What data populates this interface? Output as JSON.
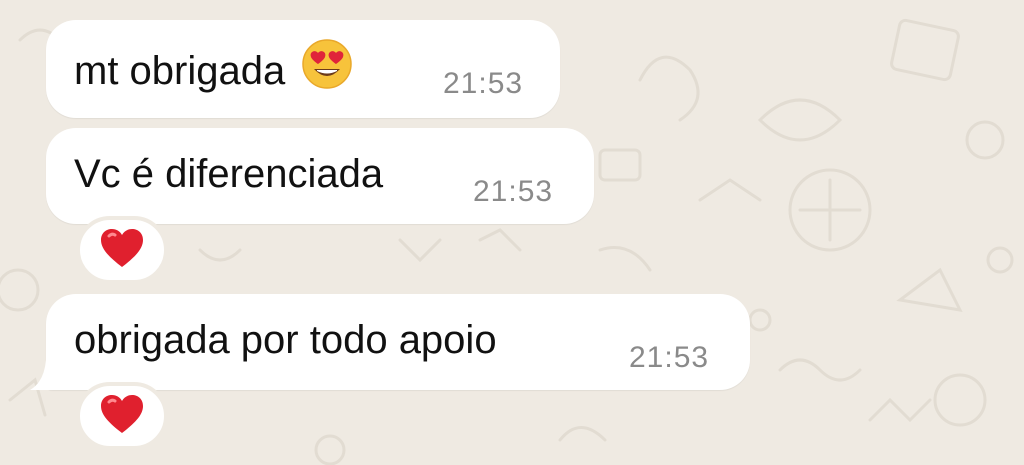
{
  "chat": {
    "background_color": "#efeae2",
    "bubble_color": "#ffffff",
    "messages": [
      {
        "text": "mt obrigada",
        "emoji": "smiling-face-with-heart-eyes",
        "time": "21:53"
      },
      {
        "text": "Vc é diferenciada",
        "time": "21:53",
        "reaction": "red-heart"
      },
      {
        "text": "obrigada por todo apoio",
        "time": "21:53",
        "reaction": "red-heart"
      }
    ]
  }
}
